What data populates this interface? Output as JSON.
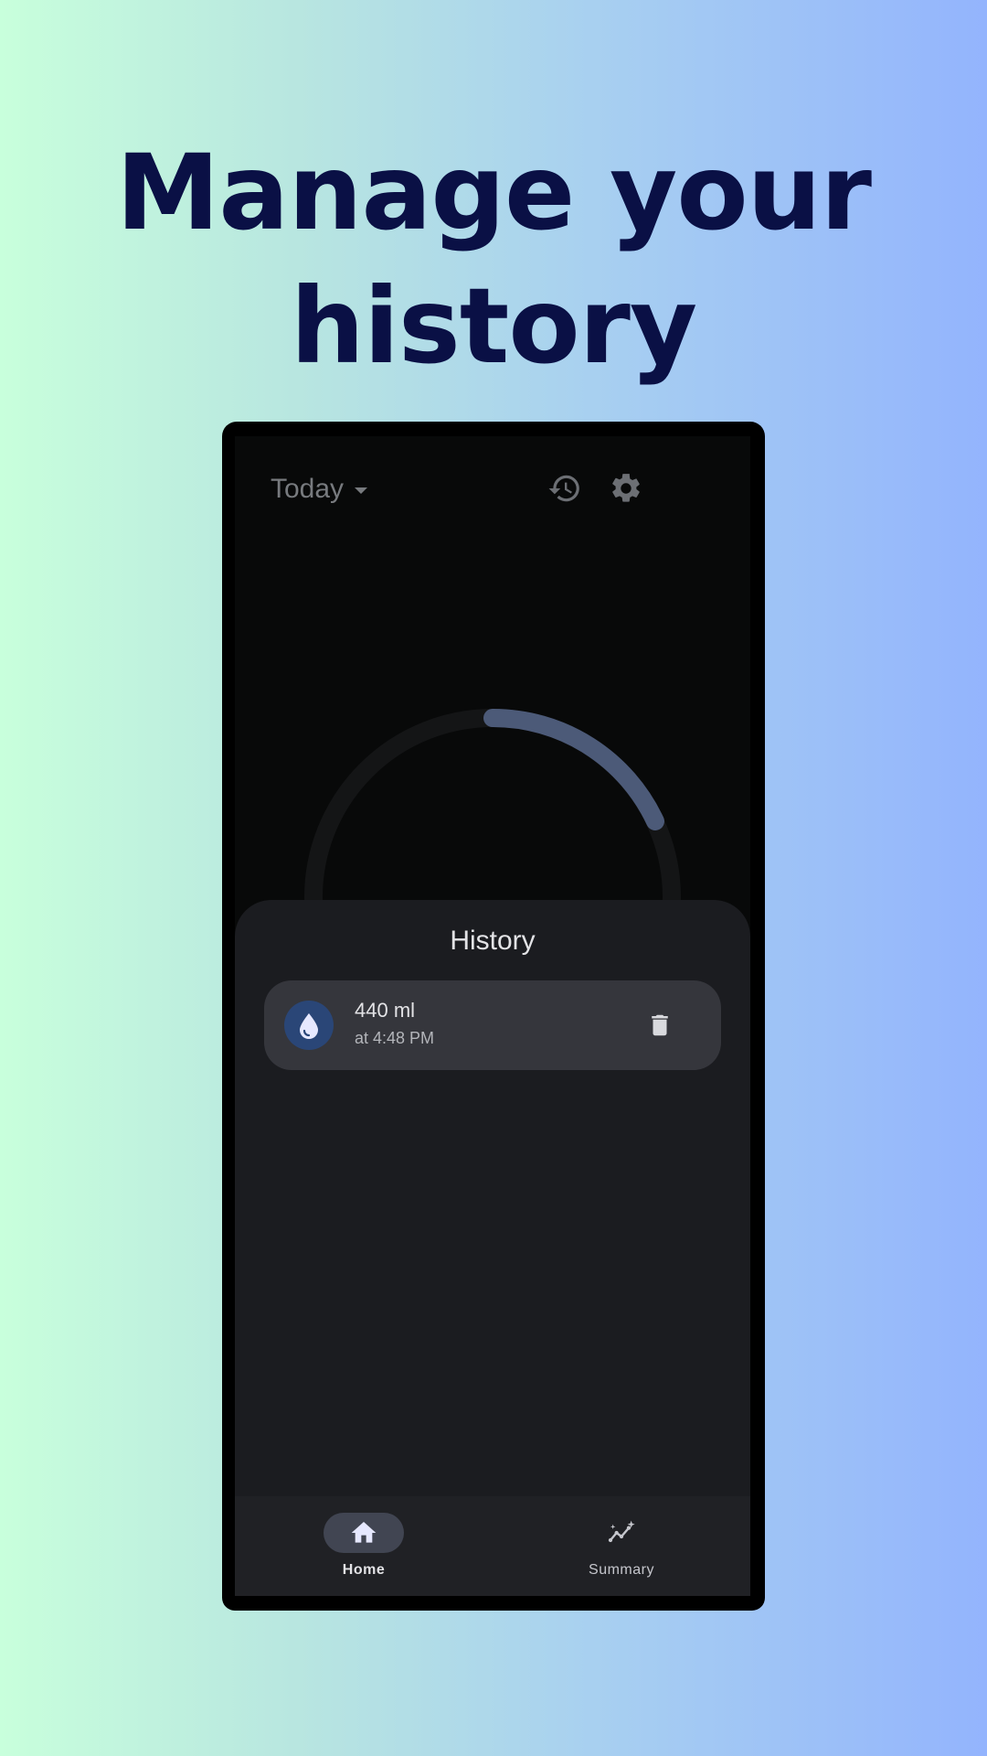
{
  "headline": {
    "line1": "Manage your",
    "line2": "history"
  },
  "app_bar": {
    "title": "Today",
    "title_dropdown_icon": "caret-down-icon",
    "history_icon": "history-icon",
    "settings_icon": "gear-icon"
  },
  "progress_ring": {
    "track_color": "#141516",
    "progress_color": "#4c5a78"
  },
  "history_sheet": {
    "title": "History",
    "items": [
      {
        "amount": "440 ml",
        "time": "at 4:48 PM",
        "icon": "water-drop-icon",
        "action_icon": "trash-icon"
      }
    ]
  },
  "bottom_nav": {
    "items": [
      {
        "label": "Home",
        "icon": "home-icon",
        "active": true
      },
      {
        "label": "Summary",
        "icon": "sparkle-chart-icon",
        "active": false
      }
    ]
  },
  "colors": {
    "headline": "#0a1045",
    "screen_bg": "#080909",
    "sheet_bg": "#1b1c20",
    "item_bg": "#35363c",
    "accent": "#2a4677"
  }
}
